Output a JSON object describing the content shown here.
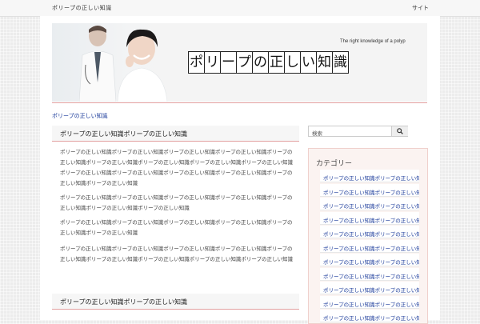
{
  "topbar": {
    "left_text": "ポリープの正しい知識",
    "right_text": "サイト"
  },
  "header": {
    "tagline": "The right knowledge of a polyp",
    "title_chars": [
      "ポ",
      "リ",
      "ー",
      "プ",
      "の",
      "正",
      "し",
      "い",
      "知",
      "識"
    ]
  },
  "breadcrumb": "ポリープの正しい知識",
  "main": {
    "heading1": "ポリープの正しい知識ポリープの正しい知識",
    "paragraphs": [
      "ポリープの正しい知識ポリープの正しい知識ポリープの正しい知識ポリープの正しい知識ポリープの正しい知識ポリープの正しい知識ポリープの正しい知識ポリープの正しい知識ポリープの正しい知識ポリープの正しい知識ポリープの正しい知識ポリープの正しい知識ポリープの正しい知識ポリープの正しい知識ポリープの正しい知識",
      "ポリープの正しい知識ポリープの正しい知識ポリープの正しい知識ポリープの正しい知識ポリープの正しい知識ポリープの正しい知識ポリープの正しい知識",
      "ポリープの正しい知識ポリープの正しい知識ポリープの正しい知識ポリープの正しい知識ポリープの正しい知識ポリープの正しい知識",
      "ポリープの正しい知識ポリープの正しい知識ポリープの正しい知識ポリープの正しい知識ポリープの正しい知識ポリープの正しい知識ポリープの正しい知識ポリープの正しい知識ポリープの正しい知識"
    ],
    "heading2": "ポリープの正しい知識ポリープの正しい知識"
  },
  "search": {
    "placeholder": "検索",
    "icon": "search-icon"
  },
  "sidebar": {
    "title": "カテゴリー",
    "items": [
      {
        "label": "ポリープの正しい知識ポリープの正しい知識"
      },
      {
        "label": "ポリープの正しい知識ポリープの正しい知識"
      },
      {
        "label": "ポリープの正しい知識ポリープの正しい知識"
      },
      {
        "label": "ポリープの正しい知識ポリープの正しい知識"
      },
      {
        "label": "ポリープの正しい知識ポリープの正しい知識"
      },
      {
        "label": "ポリープの正しい知識ポリープの正しい知識"
      },
      {
        "label": "ポリープの正しい知識ポリープの正しい知識"
      },
      {
        "label": "ポリープの正しい知識ポリープの正しい知識"
      },
      {
        "label": "ポリープの正しい知識ポリープの正しい知識"
      },
      {
        "label": "ポリープの正しい知識ポリープの正しい知識"
      },
      {
        "label": "ポリープの正しい知識ポリープの正しい知識"
      }
    ]
  },
  "colors": {
    "accent_rule": "#e3a0a0",
    "link": "#1a3a9a",
    "sidebar_bg": "#fbf3f1"
  }
}
